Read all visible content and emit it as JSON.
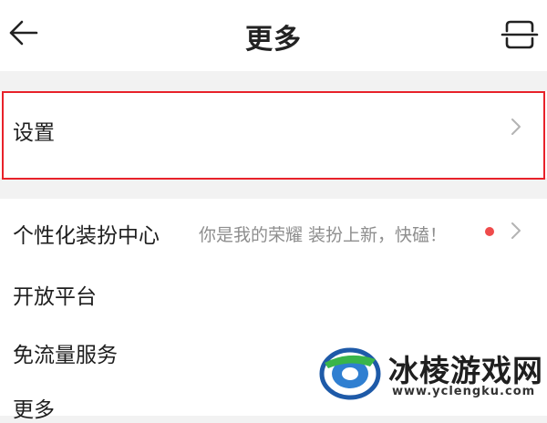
{
  "header": {
    "title": "更多",
    "back_icon": "back-arrow-icon",
    "right_icon": "scan-icon"
  },
  "menu": {
    "items": [
      {
        "label": "设置"
      },
      {
        "label": "个性化装扮中心",
        "subtitle": "你是我的荣耀 装扮上新，快磕！",
        "has_dot": true
      },
      {
        "label": "开放平台"
      },
      {
        "label": "免流量服务"
      },
      {
        "label": "更多"
      }
    ]
  },
  "highlight_color": "#e8222a",
  "dot_color": "#ef4b4b",
  "watermark": {
    "title": "冰棱游戏网",
    "url": "www.yclengku.com"
  }
}
